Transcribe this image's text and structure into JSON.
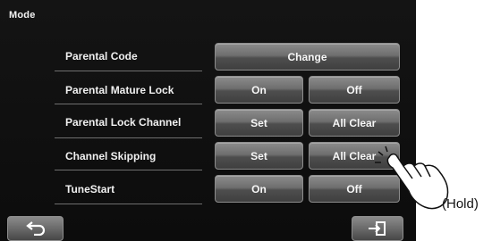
{
  "screen": {
    "title": "Mode"
  },
  "rows": [
    {
      "label": "Parental Code",
      "buttons": [
        "Change"
      ]
    },
    {
      "label": "Parental Mature Lock",
      "buttons": [
        "On",
        "Off"
      ]
    },
    {
      "label": "Parental Lock Channel",
      "buttons": [
        "Set",
        "All Clear"
      ]
    },
    {
      "label": "Channel Skipping",
      "buttons": [
        "Set",
        "All Clear"
      ]
    },
    {
      "label": "TuneStart",
      "buttons": [
        "On",
        "Off"
      ]
    }
  ],
  "bottom_bar": {
    "back_icon": "return-arrow-icon",
    "exit_icon": "exit-door-icon"
  },
  "annotation": {
    "hold_text": "(Hold)",
    "hand_icon": "pointing-hand-icon"
  }
}
